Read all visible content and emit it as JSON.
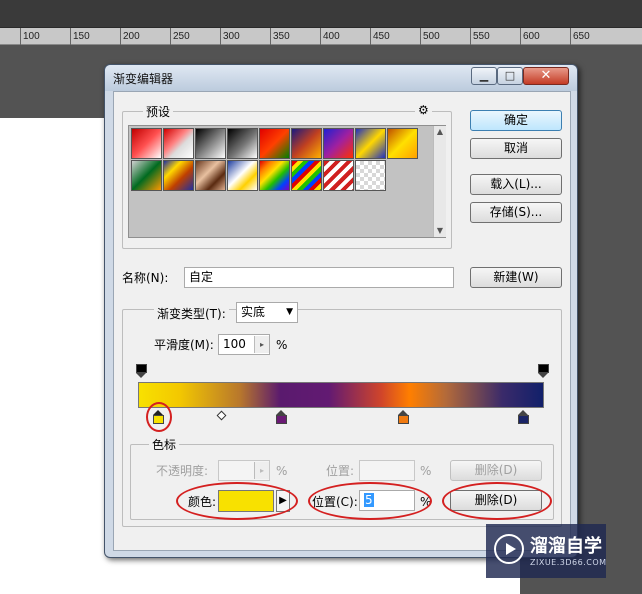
{
  "ruler": {
    "ticks": [
      "100",
      "150",
      "200",
      "250",
      "300",
      "350",
      "400",
      "450",
      "500",
      "550",
      "600",
      "650"
    ]
  },
  "dialog": {
    "title": "渐变编辑器",
    "window_buttons": {
      "minimize": "▁",
      "maximize": "□",
      "close": "✕"
    },
    "presets_legend": "预设",
    "gear_icon": "⚙",
    "buttons": {
      "ok": "确定",
      "cancel": "取消",
      "load": "载入(L)...",
      "save": "存储(S)...",
      "new": "新建(W)"
    },
    "name_label": "名称(N):",
    "name_value": "自定",
    "gradient_type_label": "渐变类型(T):",
    "gradient_type_value": "实底",
    "smoothness_label": "平滑度(M):",
    "smoothness_value": "100",
    "percent": "%",
    "stops_legend": "色标",
    "opacity_label": "不透明度:",
    "opacity_value": "",
    "opacity_location_label": "位置:",
    "opacity_location_value": "",
    "opacity_delete": "删除(D)",
    "color_label": "颜色:",
    "color_value": "#f8e100",
    "color_location_label": "位置(C):",
    "color_location_value": "5",
    "color_delete": "删除(D)"
  },
  "watermark": {
    "text": "溜溜自学",
    "sub": "ZIXUE.3D66.COM"
  },
  "colors": {
    "stop1": "#f8e100",
    "stop2": "#6a1a74",
    "stop3": "#f07a10",
    "stop4": "#1a2466"
  }
}
